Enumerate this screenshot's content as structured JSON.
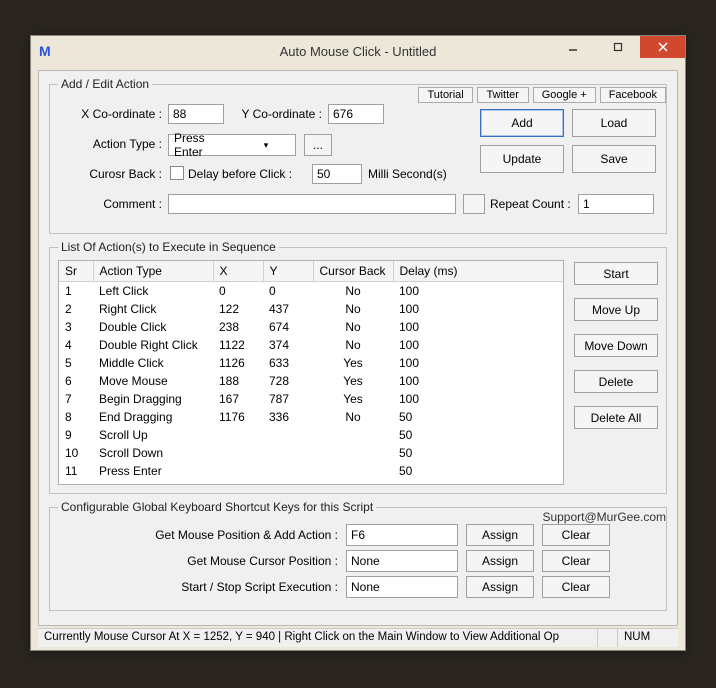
{
  "window": {
    "title": "Auto Mouse Click - Untitled"
  },
  "topLinks": {
    "tutorial": "Tutorial",
    "twitter": "Twitter",
    "google": "Google +",
    "facebook": "Facebook"
  },
  "addEdit": {
    "legend": "Add / Edit Action",
    "xcoord_label": "X Co-ordinate :",
    "xcoord_value": "88",
    "ycoord_label": "Y Co-ordinate :",
    "ycoord_value": "676",
    "action_type_label": "Action Type :",
    "action_type_value": "Press Enter",
    "cursor_back_label": "Curosr Back :",
    "delay_label": "Delay before Click :",
    "delay_value": "50",
    "delay_unit": "Milli Second(s)",
    "comment_label": "Comment :",
    "comment_value": "",
    "repeat_label": "Repeat Count :",
    "repeat_value": "1",
    "btn_add": "Add",
    "btn_load": "Load",
    "btn_update": "Update",
    "btn_save": "Save"
  },
  "list": {
    "legend": "List Of Action(s) to Execute in Sequence",
    "headers": {
      "sr": "Sr",
      "type": "Action Type",
      "x": "X",
      "y": "Y",
      "cursor": "Cursor Back",
      "delay": "Delay (ms)"
    },
    "rows": [
      {
        "sr": "1",
        "type": "Left Click",
        "x": "0",
        "y": "0",
        "cursor": "No",
        "delay": "100"
      },
      {
        "sr": "2",
        "type": "Right Click",
        "x": "122",
        "y": "437",
        "cursor": "No",
        "delay": "100"
      },
      {
        "sr": "3",
        "type": "Double Click",
        "x": "238",
        "y": "674",
        "cursor": "No",
        "delay": "100"
      },
      {
        "sr": "4",
        "type": "Double Right Click",
        "x": "1122",
        "y": "374",
        "cursor": "No",
        "delay": "100"
      },
      {
        "sr": "5",
        "type": "Middle Click",
        "x": "1126",
        "y": "633",
        "cursor": "Yes",
        "delay": "100"
      },
      {
        "sr": "6",
        "type": "Move Mouse",
        "x": "188",
        "y": "728",
        "cursor": "Yes",
        "delay": "100"
      },
      {
        "sr": "7",
        "type": "Begin Dragging",
        "x": "167",
        "y": "787",
        "cursor": "Yes",
        "delay": "100"
      },
      {
        "sr": "8",
        "type": "End Dragging",
        "x": "1176",
        "y": "336",
        "cursor": "No",
        "delay": "50"
      },
      {
        "sr": "9",
        "type": "Scroll Up",
        "x": "",
        "y": "",
        "cursor": "",
        "delay": "50"
      },
      {
        "sr": "10",
        "type": "Scroll Down",
        "x": "",
        "y": "",
        "cursor": "",
        "delay": "50"
      },
      {
        "sr": "11",
        "type": "Press Enter",
        "x": "",
        "y": "",
        "cursor": "",
        "delay": "50"
      }
    ],
    "btn_start": "Start",
    "btn_moveup": "Move Up",
    "btn_movedown": "Move Down",
    "btn_delete": "Delete",
    "btn_deleteall": "Delete All"
  },
  "shortcuts": {
    "legend": "Configurable Global Keyboard Shortcut Keys for this Script",
    "support": "Support@MurGee.com",
    "row1_label": "Get Mouse Position & Add Action :",
    "row1_value": "F6",
    "row2_label": "Get Mouse Cursor Position :",
    "row2_value": "None",
    "row3_label": "Start / Stop Script Execution :",
    "row3_value": "None",
    "btn_assign": "Assign",
    "btn_clear": "Clear"
  },
  "status": {
    "main": "Currently Mouse Cursor At X = 1252, Y = 940 | Right Click on the Main Window to View Additional Op",
    "num": "NUM"
  }
}
